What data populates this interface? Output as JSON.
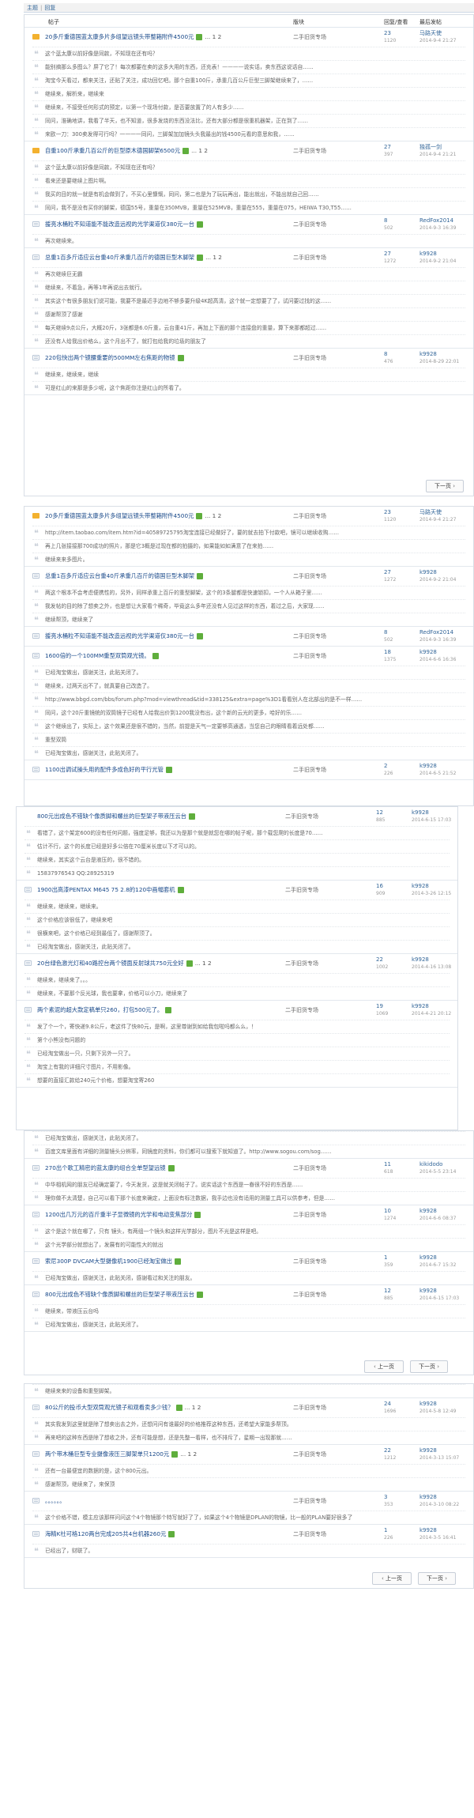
{
  "breadcrumb": {
    "home": "主题",
    "sep": "|",
    "current": "回复"
  },
  "headers": {
    "topic": "帖子",
    "section": "版块",
    "replies": "回复/查看",
    "last": "最后发帖"
  },
  "section": "二手旧货专场",
  "block1": [
    {
      "icon": "hot",
      "title": "20多斤重德国蓝太康多片多组望远镜头带整箱附件4500元",
      "attach": true,
      "pages": "... 1  2",
      "r": "23",
      "v": "1120",
      "u": "马路天使",
      "d": "2014-9-4 21:27",
      "replies": [
        "这个蓝太康以前好像是同款，不知现在还有吗？",
        "能别搞那么多图么？屏了它了！每次都要在卖的这多大用的东西，还充表！————说实话，卖东西这说话自……",
        "淘宝今天看过，都来关注，还贴了关注，成功回忆吧。那个自重100斤，承重几百公斤巨型三脚架继续来了，……",
        "继续来，解析来，继续来",
        "继续来，不接受任何形式的预定，以第一个现场付款，是否要放置了的人有多少……",
        "同问，淮确地讲，我看了半天，也不知道，很多发烧的东西没法比，还有大部分都是很重机器架，正在到了……",
        "来欧一刀：300卖发得可行吗？一一一一同问，三脚架加加镜头头我最出的钱4500元看的意思和我，……"
      ]
    },
    {
      "icon": "hot",
      "title": "自重100斤承重几百公斤的巨型原木德国脚架6500元",
      "attach": true,
      "pages": "... 1  2",
      "r": "27",
      "v": "397",
      "u": "独孤一剑",
      "d": "2014-9-4 21:21",
      "replies": [
        "这个蓝太康以前好像是同款，不知现在还有吗？",
        "看来还是要继续上图片啊。",
        "我买的目的就一就是有机会做到了，不买心里慷慨，同问，第二也是为了玩玩再出，能出就出，不能出就自己回……",
        "同问，我不是没有买你的脚架，德国55号，重量在350MVB，重量在525MVB，重量在555，重量在075，HEIWA T30,T55……"
      ]
    },
    {
      "icon": "norm",
      "title": "援亮水桶粒不知道能不能改造远视的光学渠道仅380元一台",
      "attach": true,
      "pages": "",
      "r": "8",
      "v": "502",
      "u": "RedFox2014",
      "d": "2014-9-3 16:39",
      "replies": [
        "再次继续来。"
      ]
    },
    {
      "icon": "norm",
      "title": "总重1百多斤适应云台重40斤承重几百斤的德国巨型木脚架",
      "attach": true,
      "pages": "... 1  2",
      "r": "27",
      "v": "1272",
      "u": "k9928",
      "d": "2014-9-2 21:04",
      "replies": [
        "再次继续巨无霸",
        "继续来，不着急，再等1年再说出去就行。",
        "其实这个有很多朋友们说可能，我要不是最近手边地不够多要升级4K超高清，这个就一定想要了了，试问要过找的这……",
        "感谢帮顶了感谢",
        "每天继续9点公斤，大概20斤，3张都是6.0斤重，云台重41斤，再加上下面的那个连接盘的重量，算下来那都超过……",
        "还没有人给我出价格么，这个月出不了，就打包给我的垃圾的朋友了"
      ]
    },
    {
      "icon": "norm",
      "title": "220包快出两个镜腰重要的500MM左右焦距的物镜",
      "attach": true,
      "pages": "",
      "r": "8",
      "v": "476",
      "u": "k9928",
      "d": "2014-8-29 22:01",
      "replies": [
        "继续来，继续来，继续",
        "可是红山的来那是多少呢，这个焦距你注是红山的所看了。"
      ]
    }
  ],
  "block2": [
    {
      "icon": "hot",
      "title": "20多斤重德国蓝太康多片多组望远镜头带整箱附件4500元",
      "attach": true,
      "pages": "... 1  2",
      "r": "23",
      "v": "1120",
      "u": "马路天使",
      "d": "2014-9-4 21:27",
      "replies": [
        "http://item.taobao.com/item.htm?id=40589725795淘宝连接已经做好了，要的就去拍下付款吧，镜可以继续收购……",
        "再上几张接接那700成功的照片，那是它3概是过现在都的拍摄的，如果能如如满意了在来拍……",
        "继续来来多图片。"
      ]
    },
    {
      "icon": "norm",
      "title": "总重1百多斤适应云台重40斤承重几百斤的德国巨型木脚架",
      "attach": true,
      "pages": "",
      "r": "27",
      "v": "1272",
      "u": "k9928",
      "d": "2014-9-2 21:04",
      "replies": [
        "两这个根本不会考虑便携性的，另外，同样承重上百斤的重型脚架，这个的3条腿都是快速锁扣，一个人从箱子里……",
        "我发帖的目的除了想卖之外，也是想让大家看个稀奇，毕竟这么多年还没有人见过这样的东西，着过之后，大家现……",
        "继续帮顶，继续来了"
      ]
    },
    {
      "icon": "norm",
      "title": "援亮水桶粒不知道能不能改造远视的光学渠道仅380元一台",
      "attach": true,
      "pages": "",
      "r": "8",
      "v": "502",
      "u": "RedFox2014",
      "d": "2014-9-3 16:39",
      "replies": []
    },
    {
      "icon": "norm",
      "title": "1600倍的一个100MM重型双筒观光镜。",
      "attach": true,
      "pages": "",
      "r": "18",
      "v": "1375",
      "u": "k9928",
      "d": "2014-6-6 16:36",
      "replies": [
        "已经淘宝做出，感谢关注，此贴关闭了。",
        "继续来，过两天出不了，就真要自己改造了。",
        "http://www.bbgd.com/bbs/forum.php?mod=viewthread&tid=338125&extra=page%3D1看看别人在北部出的是不一样……",
        "同问，这个20斤重镜统的双筒镜子已经有人给我出价到1200我没有出，这个新的云光的更多，哈好的乐……",
        "这个继续出了，实际上，这个效果还是很不错的，当然，前提是天气一定要够高通透，当您自己的眼睛看着远处都……",
        "重型双筒",
        "已经淘宝做出，感谢关注，此贴关闭了。"
      ]
    },
    {
      "icon": "norm",
      "title": "1100出调试操头用的配件多成色好的平行光管",
      "attach": true,
      "pages": "",
      "r": "2",
      "v": "226",
      "u": "k9928",
      "d": "2014-6-5 21:52",
      "replies": []
    }
  ],
  "block3": [
    {
      "icon": "none",
      "title": "800元出成色不错缺个像质脚和螺丝的巨型架子带液压云台",
      "attach": true,
      "pages": "",
      "r": "12",
      "v": "885",
      "u": "k9928",
      "d": "2014-6-15 17:03",
      "replies": [
        "看错了，这个架定600的没有任何问题，强度足够，我还以为是那个就是就您在哪的帖子呢，那个载您爬的长度是70……",
        "估计不行，这个的长度已经是好多公倍在70厘米长度以下才可以的。",
        "继续来，其实这个云台是液压的，很不错的。",
        "15837976543 QQ:28925319"
      ]
    },
    {
      "icon": "norm",
      "title": "1900出高漆PENTAX M645 75 2.8的120中画幅套机",
      "attach": true,
      "pages": "",
      "r": "16",
      "v": "909",
      "u": "k9928",
      "d": "2014-3-26 12:15",
      "replies": [
        "继续来，继续来，继续来。",
        "这个价格应该很低了，继续来吧",
        "很横来吧，这个价格已经到最低了，感谢帮顶了。",
        "已经淘宝做出，感谢关注，此贴关闭了。"
      ]
    },
    {
      "icon": "norm",
      "title": "20台绿色激光灯和40路控台两个镜面反射球共750元全好",
      "attach": true,
      "pages": "... 1  2",
      "r": "22",
      "v": "1002",
      "u": "k9928",
      "d": "2014-4-16 13:08",
      "replies": [
        "继续来，继续来了。。。",
        "继续来，不要那个反光球，我也要拿，价格可以小刀，继续来了"
      ]
    },
    {
      "icon": "norm",
      "title": "两个素泥的超大款定稿单只260，打包500元了。",
      "attach": true,
      "pages": "",
      "r": "19",
      "v": "1069",
      "u": "k9928",
      "d": "2014-4-21 20:12",
      "replies": [
        "发了个一个，寄快递9.8公斤，老这件了快80元，是啊，这里尊谢到如给我包啦吗都么么，！",
        "第个小熊没有问题的",
        "已经淘宝做出一只，只剩下另外一只了。",
        "淘宝上有我的详细尺寸图片，不用影像。",
        "想要的直接汇款给240元个价格，想要淘宝寄260"
      ]
    }
  ],
  "block4": [
    {
      "icon": "none",
      "title": "",
      "attach": false,
      "pages": "",
      "r": "",
      "v": "",
      "u": "",
      "d": "",
      "replies": [
        "已经淘宝做出，感谢关注，此贴关闭了。",
        "百度文库里面有详细的测量镜头分辨率，同镜度的资料，你们都可以搜索下就知道了。http://www.sogou.com/sog……"
      ]
    },
    {
      "icon": "norm",
      "title": "270出个歌工精密的蓝太康的组合全单型望远镜",
      "attach": true,
      "pages": "",
      "r": "11",
      "v": "618",
      "u": "kikidodo",
      "d": "2014-5-5 23:14",
      "replies": [
        "中华相机网的朋友已经确定要了，今天发货，这是就关闭帖子了。说实话这个东西是一眷很不好的东西是……",
        "理你做不太清楚，自己可以看下那个长度来确定，上面没有标注数据，我手边也没有适用的测量工具可以供参考，但是……"
      ]
    },
    {
      "icon": "norm",
      "title": "1200出几万元的百斤重半子显微镜的光学和电动变焦部分",
      "attach": true,
      "pages": "",
      "r": "10",
      "v": "1274",
      "u": "k9928",
      "d": "2014-6-6 08:37",
      "replies": [
        "这个是这个就在哪了，只有 镜头，有两组一个镜头和这样光学部分，图片不光是这样是吧。",
        "这个光学部分就想出了，发展有的可能性大的就出"
      ]
    },
    {
      "icon": "norm",
      "title": "索尼300P DVCAM大型摄像机1900已经淘宝做出",
      "attach": true,
      "pages": "",
      "r": "1",
      "v": "359",
      "u": "k9928",
      "d": "2014-6-7 15:32",
      "replies": [
        "已经淘宝做出，感谢关注，此贴关闭，感谢看过和关注的朋友。"
      ]
    },
    {
      "icon": "norm",
      "title": "800元出成色不错缺个像质脚和螺丝的巨型架子带液压云台",
      "attach": true,
      "pages": "",
      "r": "12",
      "v": "885",
      "u": "k9928",
      "d": "2014-6-15 17:03",
      "replies": [
        "继续来，带液压云台吗",
        "已经淘宝做出，感谢关注，此贴关闭了。"
      ]
    }
  ],
  "block5": [
    {
      "icon": "none",
      "title": "",
      "attach": false,
      "pages": "",
      "r": "",
      "v": "",
      "u": "",
      "d": "",
      "replies": [
        "继续来来的设备和重型脚架。"
      ]
    },
    {
      "icon": "norm",
      "title": "80公斤的投币大型双筒观光镜子和观看卖多少钱？",
      "attach": true,
      "pages": "... 1  2",
      "r": "24",
      "v": "1696",
      "u": "k9928",
      "d": "2014-5-8 12:49",
      "replies": [
        "其实我发到这里就是除了想卖出去之外，还想问问有谁最好的价格推荐这种东西，还希望大家能多帮顶。",
        "再来吧的这种东西是除了想收之外，还有可能是想，还是先整一看样，也不排斥了，星期一出现那就……"
      ]
    },
    {
      "icon": "norm",
      "title": "两个带木桶巨型专业摄像液压三脚架单只1200元",
      "attach": true,
      "pages": "... 1  2",
      "r": "22",
      "v": "1212",
      "u": "k9928",
      "d": "2014-3-13 15:07",
      "replies": [
        "还有一台最便宜的数据的是，这个800元出。",
        "感谢帮顶，继续来了，来保顶"
      ]
    },
    {
      "icon": "norm",
      "title": "。。。。。。",
      "attach": false,
      "pages": "",
      "r": "3",
      "v": "353",
      "u": "k9928",
      "d": "2014-3-10 08:22",
      "replies": [
        "这个价格不错，模主应该那样问问这个4个物镜那个特写就好了了，如果这个4个物镜是DPLAN的物镜，比一般的PLAN要好很多了"
      ]
    },
    {
      "icon": "norm",
      "title": "海精K社可格120两台完成205共4台机器260元",
      "attach": true,
      "pages": "",
      "r": "1",
      "v": "226",
      "u": "k9928",
      "d": "2014-3-5 16:41",
      "replies": [
        "已经出了，财联了。"
      ]
    }
  ],
  "pager": {
    "next": "下一页",
    "prev": "上一页"
  }
}
